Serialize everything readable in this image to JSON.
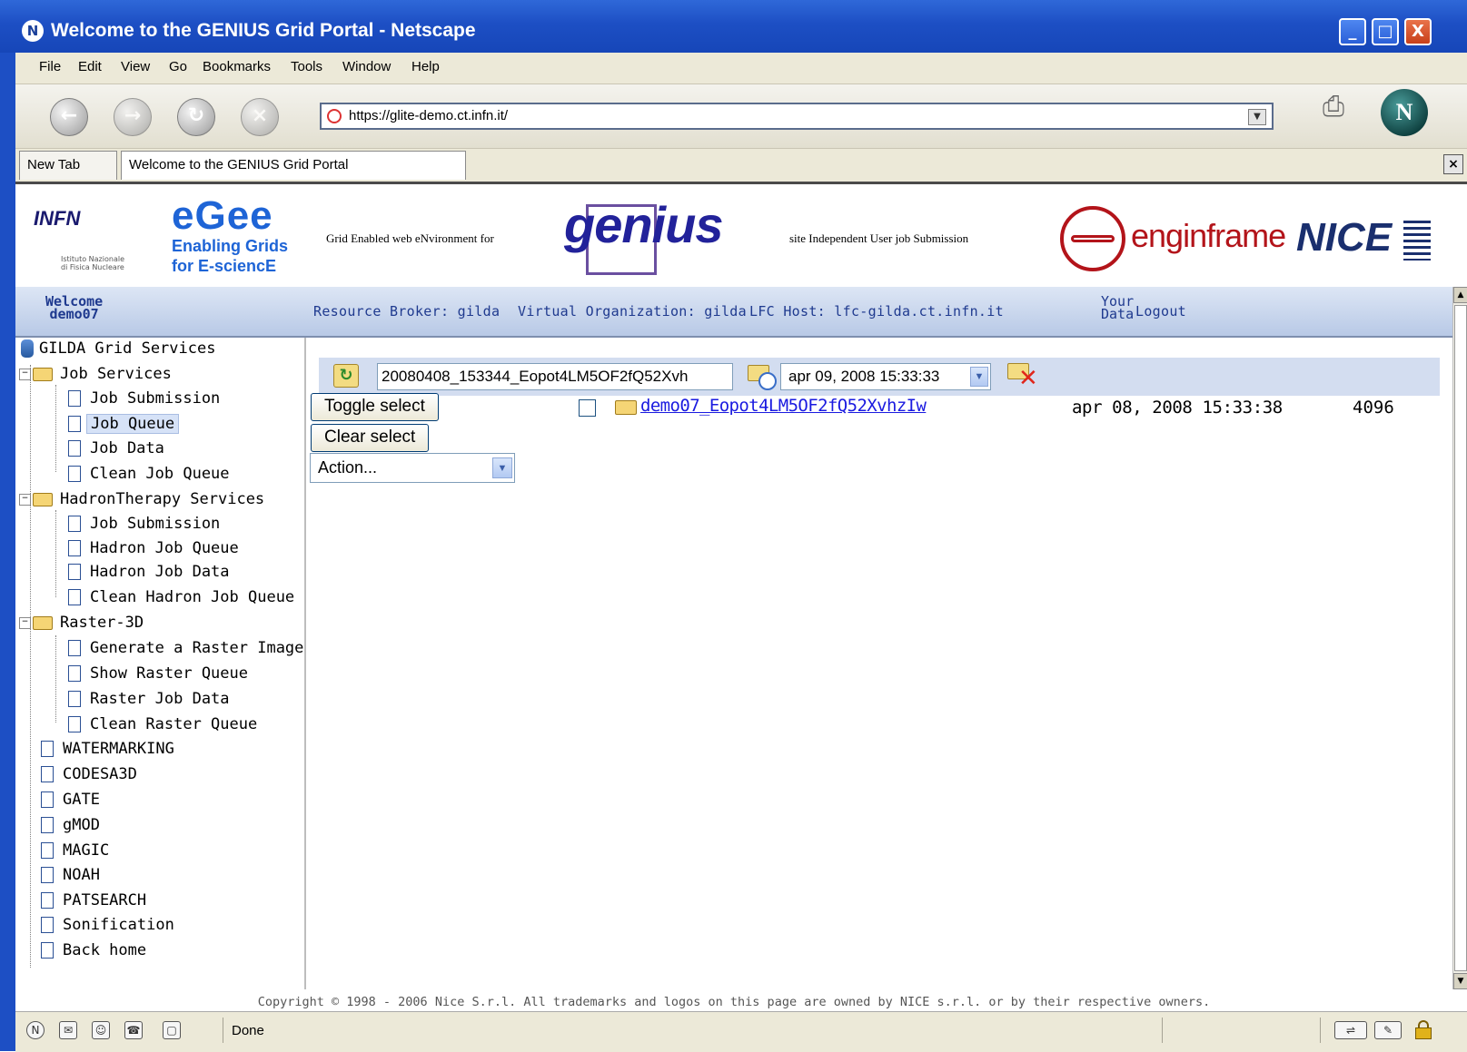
{
  "window": {
    "title": "Welcome to the GENIUS Grid Portal - Netscape",
    "app_icon_glyph": "N",
    "minimize_glyph": "_",
    "maximize_glyph": "□",
    "close_glyph": "X"
  },
  "menu": [
    "File",
    "Edit",
    "View",
    "Go",
    "Bookmarks",
    "Tools",
    "Window",
    "Help"
  ],
  "nav": {
    "back_glyph": "←",
    "forward_glyph": "→",
    "reload_glyph": "↻",
    "stop_glyph": "×",
    "url": "https://glite-demo.ct.infn.it/",
    "netscape_glyph": "N"
  },
  "tabs": {
    "new_tab": "New Tab",
    "active_tab": "Welcome to the GENIUS Grid Portal"
  },
  "logos": {
    "infn": "INFN",
    "infn_sub_1": "Istituto Nazionale",
    "infn_sub_2": "di Fisica Nucleare",
    "egee": "eGee",
    "egee_line1": "Enabling Grids",
    "egee_line2": "for E-sciencE",
    "genius_tagline": "Grid Enabled web eNvironment for",
    "genius": "genius",
    "site_tagline": "site Independent User job Submission",
    "enginframe": "enginframe",
    "nice": "NICE"
  },
  "infobar": {
    "welcome_line1": "Welcome",
    "welcome_line2": "demo07",
    "resource_broker": "Resource Broker: gilda",
    "virtual_org": "Virtual Organization: gilda",
    "lfc_host": "LFC Host: lfc-gilda.ct.infn.it",
    "your_data_line1": "Your",
    "your_data_line2": "Data",
    "logout": "Logout"
  },
  "sidebar": {
    "root": "GILDA Grid Services",
    "groups": [
      {
        "label": "Job Services",
        "items": [
          "Job Submission",
          "Job Queue",
          "Job Data",
          "Clean Job Queue"
        ]
      },
      {
        "label": "HadronTherapy Services",
        "items": [
          "Job Submission",
          "Hadron Job Queue",
          "Hadron Job Data",
          "Clean Hadron Job Queue"
        ]
      },
      {
        "label": "Raster-3D",
        "items": [
          "Generate a Raster Image",
          "Show Raster Queue",
          "Raster Job Data",
          "Clean Raster Queue"
        ]
      }
    ],
    "leaves": [
      "WATERMARKING",
      "CODESA3D",
      "GATE",
      "gMOD",
      "MAGIC",
      "NOAH",
      "PATSEARCH",
      "Sonification",
      "Back home"
    ],
    "selected": "Job Queue"
  },
  "main": {
    "job_id_value": "20080408_153344_Eopot4LM5OF2fQ52Xvh",
    "date_value": "apr 09, 2008 15:33:33",
    "toggle_select": "Toggle select",
    "clear_select": "Clear select",
    "action_value": "Action...",
    "job": {
      "name": "demo07_Eopot4LM5OF2fQ52XvhzIw",
      "date": "apr 08, 2008 15:33:38",
      "size": "4096"
    }
  },
  "copyright": "Copyright © 1998 - 2006 Nice S.r.l. All trademarks and logos on this page are owned by NICE s.r.l. or by their respective owners.",
  "status": {
    "text": "Done"
  }
}
